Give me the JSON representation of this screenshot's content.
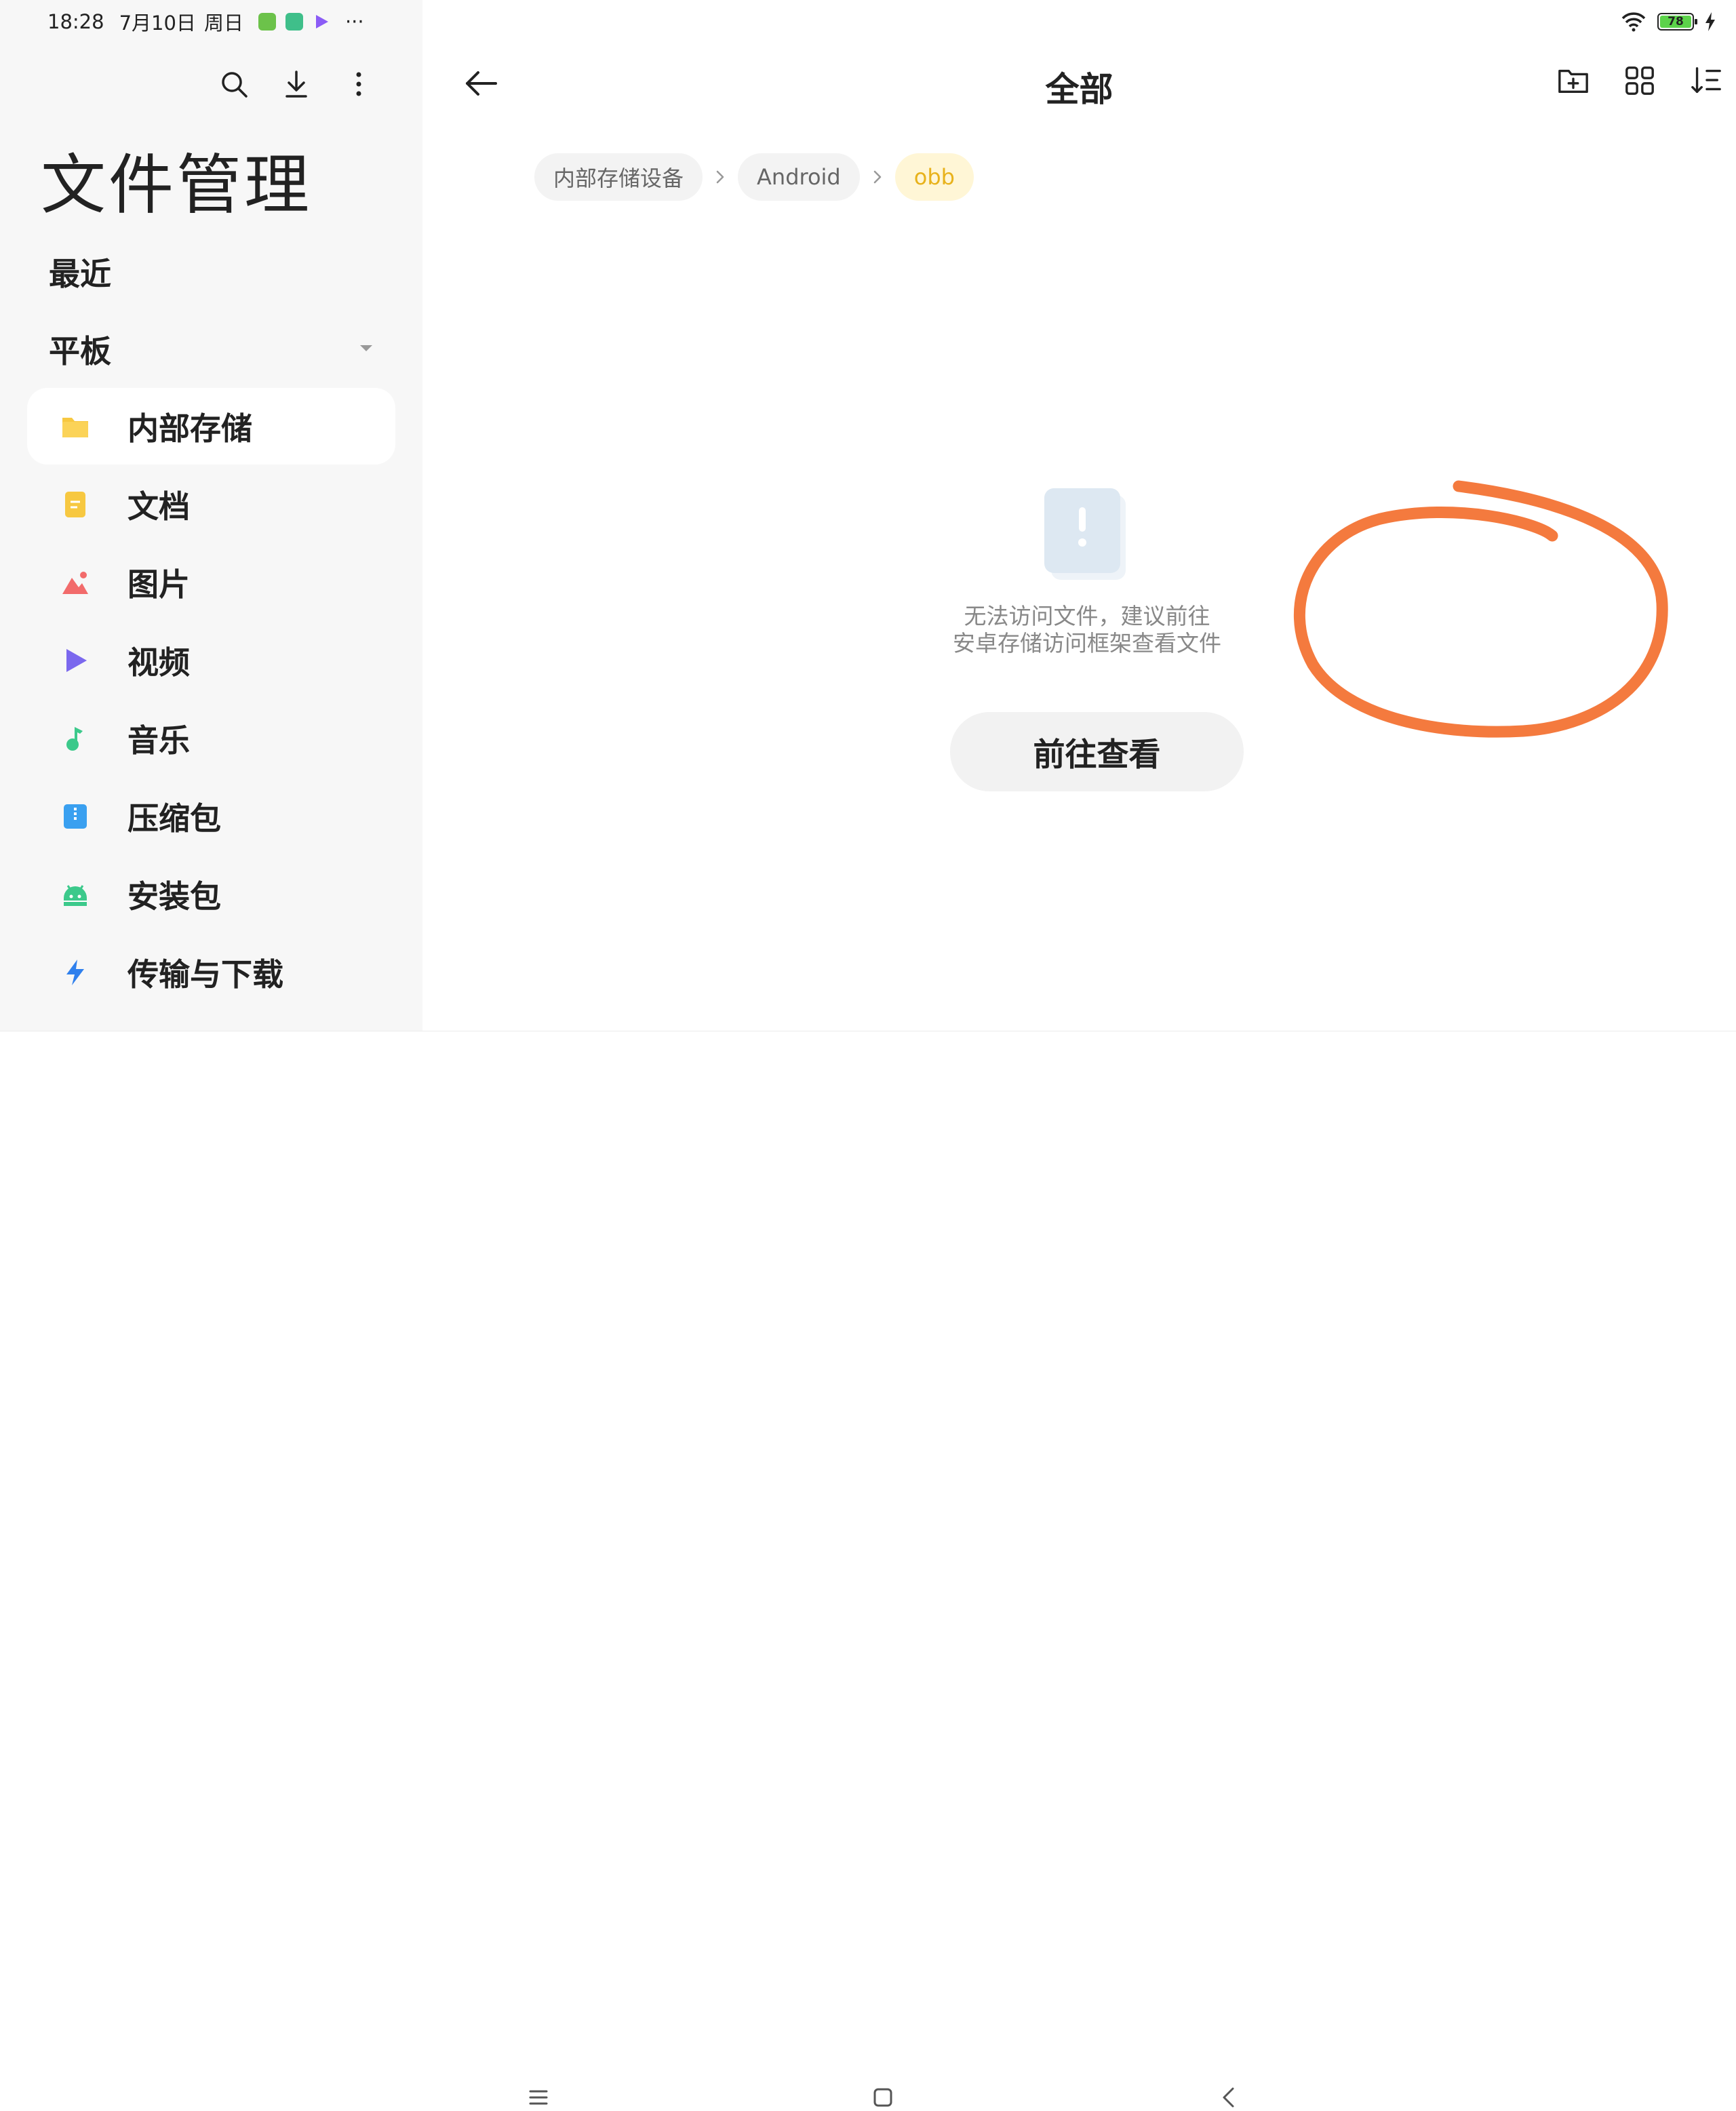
{
  "status": {
    "time": "18:28",
    "date": "7月10日",
    "weekday": "周日",
    "more": "···",
    "battery": "78",
    "app_icon_colors": [
      "#6cc24a",
      "#3fbf8a",
      "#8b5cf6"
    ]
  },
  "sidebar": {
    "app_title": "文件管理",
    "section_recent": "最近",
    "section_tablet": "平板",
    "items": [
      {
        "label": "内部存储",
        "icon": "folder-icon",
        "color": "#f7c841",
        "active": true
      },
      {
        "label": "文档",
        "icon": "document-icon",
        "color": "#f7c841"
      },
      {
        "label": "图片",
        "icon": "picture-icon",
        "color": "#f26b6b"
      },
      {
        "label": "视频",
        "icon": "video-icon",
        "color": "#7b68ee"
      },
      {
        "label": "音乐",
        "icon": "music-icon",
        "color": "#3cc98b"
      },
      {
        "label": "压缩包",
        "icon": "archive-icon",
        "color": "#3aa0f0"
      },
      {
        "label": "安装包",
        "icon": "android-icon",
        "color": "#3cc98b"
      },
      {
        "label": "传输与下载",
        "icon": "transfer-icon",
        "color": "#2f80ed"
      }
    ]
  },
  "header": {
    "title": "全部"
  },
  "breadcrumb": [
    "内部存储设备",
    "Android",
    "obb"
  ],
  "empty_state": {
    "line1": "无法访问文件，建议前往",
    "line2": "安卓存储访问框架查看文件",
    "button_label": "前往查看"
  },
  "colors": {
    "accent": "#e8b21b",
    "annotation": "#f47a3e"
  }
}
